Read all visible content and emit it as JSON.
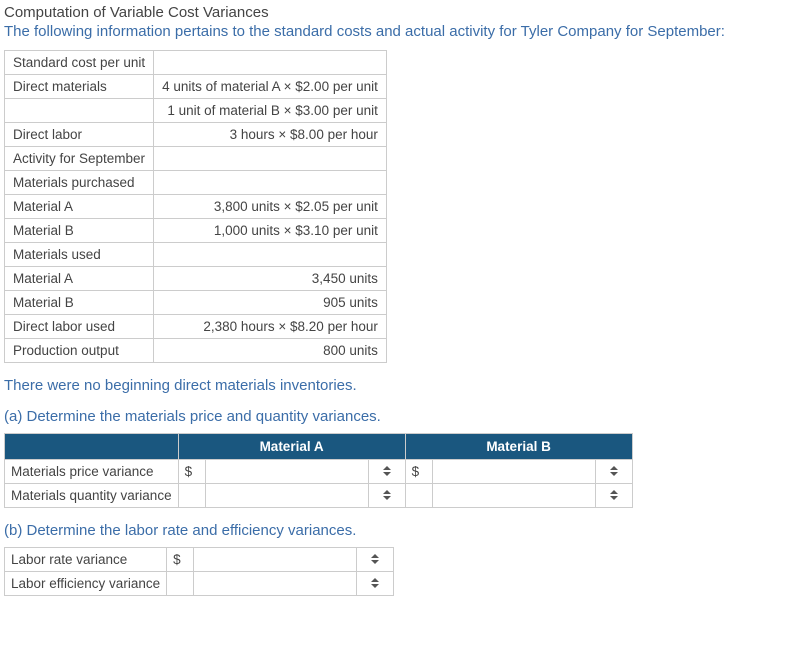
{
  "title": "Computation of Variable Cost Variances",
  "intro": "The following information pertains to the standard costs and actual activity for Tyler Company for September:",
  "std_table": {
    "rows": [
      {
        "label": "Standard cost per unit",
        "value": ""
      },
      {
        "label": "Direct materials",
        "value": "4 units of material A × $2.00 per unit"
      },
      {
        "label": "",
        "value": "1 unit of material B × $3.00 per unit"
      },
      {
        "label": "Direct labor",
        "value": "3 hours × $8.00 per hour"
      },
      {
        "label": "Activity for September",
        "value": ""
      },
      {
        "label": "Materials purchased",
        "value": ""
      },
      {
        "label": "Material A",
        "value": "3,800 units × $2.05 per unit"
      },
      {
        "label": "Material B",
        "value": "1,000 units × $3.10 per unit"
      },
      {
        "label": "Materials used",
        "value": ""
      },
      {
        "label": "Material A",
        "value": "3,450 units"
      },
      {
        "label": "Material B",
        "value": "905 units"
      },
      {
        "label": "Direct labor used",
        "value": "2,380 hours × $8.20 per hour"
      },
      {
        "label": "Production output",
        "value": "800 units"
      }
    ]
  },
  "no_beginning": "There were no beginning direct materials inventories.",
  "part_a": {
    "prompt": "(a) Determine the materials price and quantity variances.",
    "col_a": "Material A",
    "col_b": "Material B",
    "row1": "Materials price variance",
    "row2": "Materials quantity variance",
    "dollar": "$"
  },
  "part_b": {
    "prompt": "(b) Determine the labor rate and efficiency variances.",
    "row1": "Labor rate variance",
    "row2": "Labor efficiency variance",
    "dollar": "$"
  }
}
